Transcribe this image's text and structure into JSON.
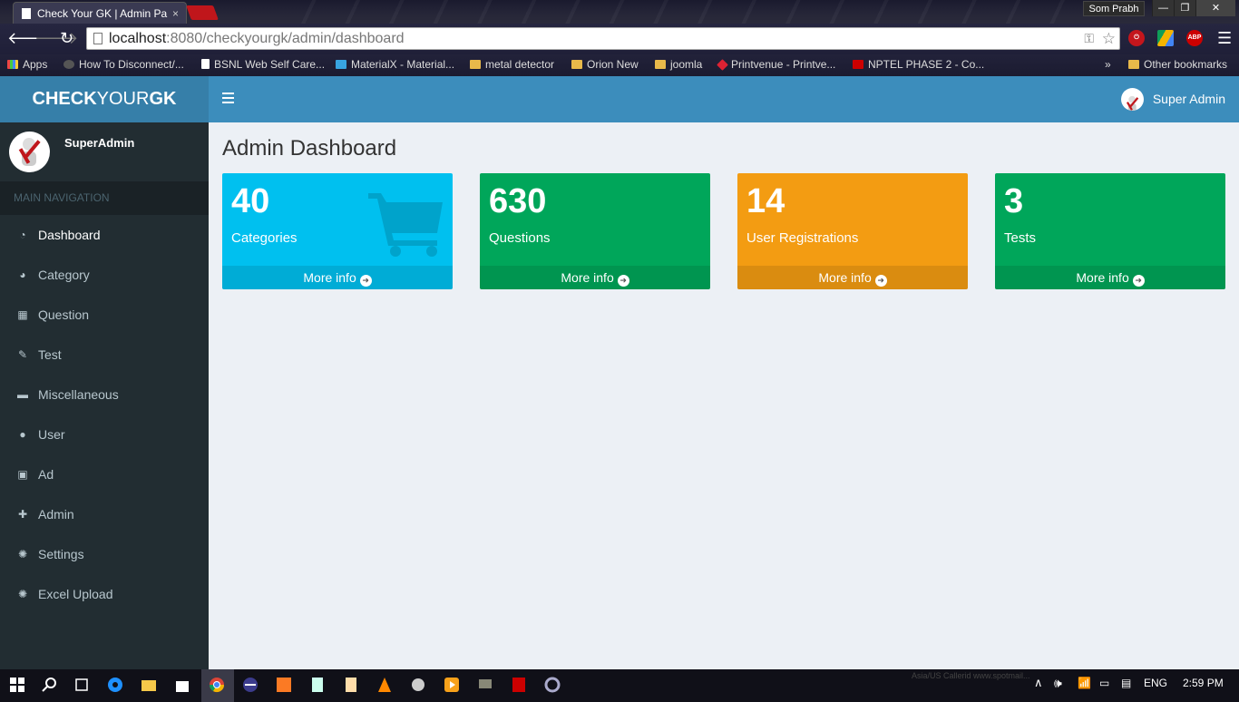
{
  "browser": {
    "tab_title": "Check Your GK | Admin Pa",
    "tab_close": "×",
    "profile_name": "Som Prabh",
    "url_host": "localhost",
    "url_rest": ":8080/checkyourgk/admin/dashboard",
    "bookmarks": [
      {
        "label": "Apps",
        "icon": "apps"
      },
      {
        "label": "How To Disconnect/...",
        "icon": "dark"
      },
      {
        "label": "BSNL Web Self Care...",
        "icon": "page"
      },
      {
        "label": "MaterialX - Material...",
        "icon": "mx"
      },
      {
        "label": "metal detector",
        "icon": "folder"
      },
      {
        "label": "Orion New",
        "icon": "folder"
      },
      {
        "label": "joomla",
        "icon": "folder"
      },
      {
        "label": "Printvenue - Printve...",
        "icon": "pv"
      },
      {
        "label": "NPTEL PHASE 2 - Co...",
        "icon": "np"
      }
    ],
    "bookmarks_overflow": "»",
    "other_bookmarks": "Other bookmarks",
    "ext_abp": "ABP"
  },
  "app": {
    "logo_bold1": "CHECK",
    "logo_light": "YOUR",
    "logo_bold2": "GK",
    "header_user": "Super Admin",
    "sidebar_user": "SuperAdmin",
    "nav_header": "MAIN NAVIGATION",
    "nav": [
      {
        "label": "Dashboard",
        "icon": "dashboard-icon",
        "glyph": "◔"
      },
      {
        "label": "Category",
        "icon": "pie-chart-icon",
        "glyph": "◕"
      },
      {
        "label": "Question",
        "icon": "grid-icon",
        "glyph": "▦"
      },
      {
        "label": "Test",
        "icon": "edit-icon",
        "glyph": "✎"
      },
      {
        "label": "Miscellaneous",
        "icon": "archive-icon",
        "glyph": "▬"
      },
      {
        "label": "User",
        "icon": "user-icon",
        "glyph": "●"
      },
      {
        "label": "Ad",
        "icon": "money-icon",
        "glyph": "▣"
      },
      {
        "label": "Admin",
        "icon": "user-plus-icon",
        "glyph": "✚"
      },
      {
        "label": "Settings",
        "icon": "gear-icon",
        "glyph": "✺"
      },
      {
        "label": "Excel Upload",
        "icon": "gear-icon",
        "glyph": "✺"
      }
    ],
    "page_title": "Admin Dashboard",
    "stats": [
      {
        "value": "40",
        "label": "Categories",
        "more": "More info",
        "color": "#00c0ef"
      },
      {
        "value": "630",
        "label": "Questions",
        "more": "More info",
        "color": "#00a65a"
      },
      {
        "value": "14",
        "label": "User Registrations",
        "more": "More info",
        "color": "#f39c12"
      },
      {
        "value": "3",
        "label": "Tests",
        "more": "More info",
        "color": "#00a65a"
      }
    ]
  },
  "taskbar": {
    "language": "ENG",
    "time": "2:59 PM",
    "faint_text": "Asia/US Callerid www.spotmail..."
  }
}
